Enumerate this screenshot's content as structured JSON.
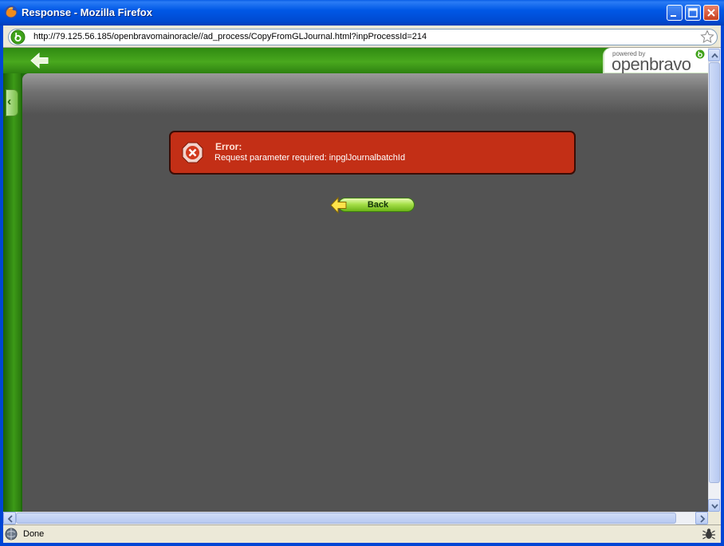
{
  "window": {
    "title": "Response - Mozilla Firefox"
  },
  "addressbar": {
    "url": "http://79.125.56.185/openbravomainoracle//ad_process/CopyFromGLJournal.html?inpProcessId=214"
  },
  "branding": {
    "powered_by": "powered by",
    "logo_text": "openbravo"
  },
  "error": {
    "title": "Error:",
    "message": "Request parameter required: inpglJournalbatchId"
  },
  "actions": {
    "back_label": "Back"
  },
  "statusbar": {
    "text": "Done"
  },
  "colors": {
    "titlebar": "#0058e6",
    "header_green": "#49a81e",
    "content_bg": "#535353",
    "error_bg": "#c32f16",
    "button_green": "#a6e04a"
  },
  "icons": [
    "firefox-icon",
    "minimize-icon",
    "maximize-icon",
    "close-icon",
    "site-identity-icon",
    "bookmark-star-icon",
    "back-arrow-icon",
    "collapse-left-icon",
    "error-x-icon",
    "status-globe-icon",
    "bug-icon"
  ]
}
